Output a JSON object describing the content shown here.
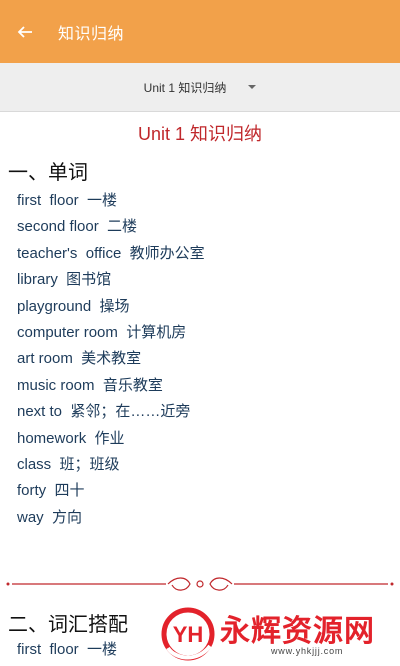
{
  "app_bar": {
    "title": "知识归纳",
    "back_icon": "back-arrow-icon",
    "background_color": "#f2a14a"
  },
  "selector": {
    "selected": "Unit 1 知识归纳",
    "icon": "dropdown-caret-icon"
  },
  "document": {
    "title": "Unit 1 知识归纳",
    "title_color": "#c0282c",
    "section1_title": "一、单词",
    "words": [
      "first  floor  一楼",
      "second floor  二楼",
      "teacher's  office  教师办公室",
      "library  图书馆",
      "playground  操场",
      "computer room  计算机房",
      "art room  美术教室",
      "music room  音乐教室",
      "next to  紧邻；在……近旁",
      "homework  作业",
      "class  班；班级",
      "forty  四十",
      "way  方向"
    ],
    "section2_title": "二、词汇搭配",
    "section2_first": "first  floor  一楼"
  },
  "watermark": {
    "logo_text": "YH",
    "brand": "永辉资源网",
    "url": "www.yhkjjj.com",
    "color": "#e3222b"
  }
}
